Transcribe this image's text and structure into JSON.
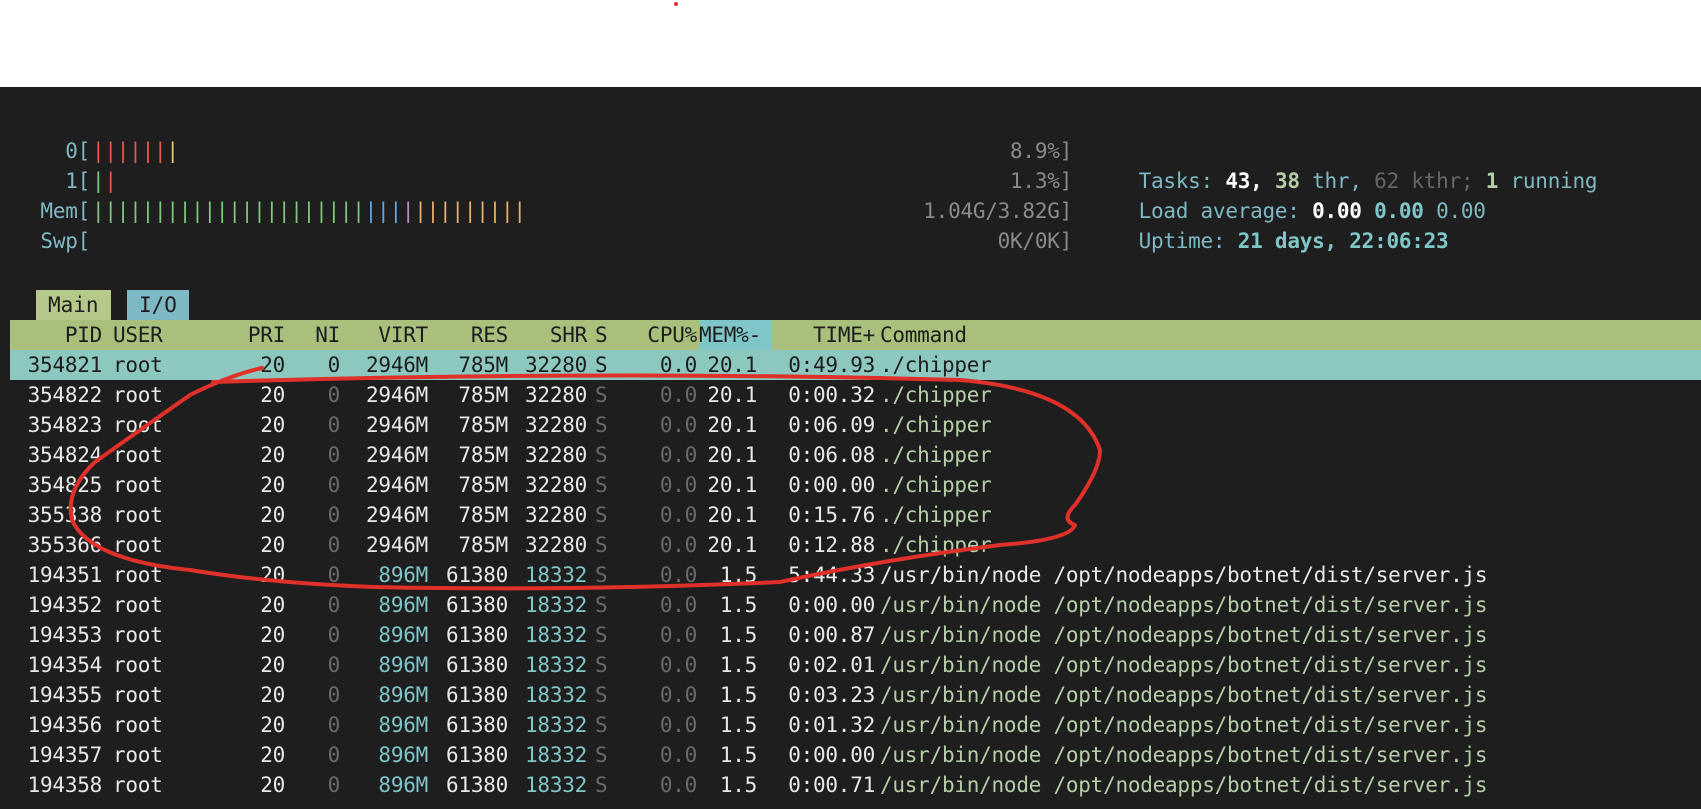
{
  "meters": {
    "cpu0": {
      "label": "0[",
      "value": "8.9%]"
    },
    "cpu1": {
      "label": "1[",
      "value": "1.3%]"
    },
    "mem": {
      "label": "Mem[",
      "value": "1.04G/3.82G]"
    },
    "swp": {
      "label": "Swp[",
      "value": "0K/0K]"
    }
  },
  "stats": {
    "tasks_label": "Tasks:",
    "tasks": "43,",
    "threads": "38",
    "threads_label": "thr,",
    "kthreads": "62",
    "kthreads_label": "kthr;",
    "running": "1",
    "running_label": "running",
    "load_label": "Load average:",
    "load1": "0.00",
    "load5": "0.00",
    "load15": "0.00",
    "uptime_label": "Uptime:",
    "uptime": "21 days, 22:06:23"
  },
  "tabs": {
    "main": "Main",
    "io": "I/O"
  },
  "columns": {
    "pid": "PID",
    "user": "USER",
    "pri": "PRI",
    "ni": "NI",
    "virt": "VIRT",
    "res": "RES",
    "shr": "SHR",
    "s": "S",
    "cpu": "CPU%",
    "mem": "MEM%-",
    "time": "TIME+",
    "command": "Command"
  },
  "rows": [
    {
      "pid": "354821",
      "user": "root",
      "pri": "20",
      "ni": "0",
      "virt": "2946M",
      "res": "785M",
      "shr": "32280",
      "s": "S",
      "cpu": "0.0",
      "mem": "20.1",
      "time": "0:49.93",
      "command": "./chipper"
    },
    {
      "pid": "354822",
      "user": "root",
      "pri": "20",
      "ni": "0",
      "virt": "2946M",
      "res": "785M",
      "shr": "32280",
      "s": "S",
      "cpu": "0.0",
      "mem": "20.1",
      "time": "0:00.32",
      "command": "./chipper"
    },
    {
      "pid": "354823",
      "user": "root",
      "pri": "20",
      "ni": "0",
      "virt": "2946M",
      "res": "785M",
      "shr": "32280",
      "s": "S",
      "cpu": "0.0",
      "mem": "20.1",
      "time": "0:06.09",
      "command": "./chipper"
    },
    {
      "pid": "354824",
      "user": "root",
      "pri": "20",
      "ni": "0",
      "virt": "2946M",
      "res": "785M",
      "shr": "32280",
      "s": "S",
      "cpu": "0.0",
      "mem": "20.1",
      "time": "0:06.08",
      "command": "./chipper"
    },
    {
      "pid": "354825",
      "user": "root",
      "pri": "20",
      "ni": "0",
      "virt": "2946M",
      "res": "785M",
      "shr": "32280",
      "s": "S",
      "cpu": "0.0",
      "mem": "20.1",
      "time": "0:00.00",
      "command": "./chipper"
    },
    {
      "pid": "355338",
      "user": "root",
      "pri": "20",
      "ni": "0",
      "virt": "2946M",
      "res": "785M",
      "shr": "32280",
      "s": "S",
      "cpu": "0.0",
      "mem": "20.1",
      "time": "0:15.76",
      "command": "./chipper"
    },
    {
      "pid": "355366",
      "user": "root",
      "pri": "20",
      "ni": "0",
      "virt": "2946M",
      "res": "785M",
      "shr": "32280",
      "s": "S",
      "cpu": "0.0",
      "mem": "20.1",
      "time": "0:12.88",
      "command": "./chipper"
    },
    {
      "pid": "194351",
      "user": "root",
      "pri": "20",
      "ni": "0",
      "virt": "896M",
      "res": "61380",
      "shr": "18332",
      "s": "S",
      "cpu": "0.0",
      "mem": "1.5",
      "time": "5:44.33",
      "command": "/usr/bin/node /opt/nodeapps/botnet/dist/server.js"
    },
    {
      "pid": "194352",
      "user": "root",
      "pri": "20",
      "ni": "0",
      "virt": "896M",
      "res": "61380",
      "shr": "18332",
      "s": "S",
      "cpu": "0.0",
      "mem": "1.5",
      "time": "0:00.00",
      "command": "/usr/bin/node /opt/nodeapps/botnet/dist/server.js"
    },
    {
      "pid": "194353",
      "user": "root",
      "pri": "20",
      "ni": "0",
      "virt": "896M",
      "res": "61380",
      "shr": "18332",
      "s": "S",
      "cpu": "0.0",
      "mem": "1.5",
      "time": "0:00.87",
      "command": "/usr/bin/node /opt/nodeapps/botnet/dist/server.js"
    },
    {
      "pid": "194354",
      "user": "root",
      "pri": "20",
      "ni": "0",
      "virt": "896M",
      "res": "61380",
      "shr": "18332",
      "s": "S",
      "cpu": "0.0",
      "mem": "1.5",
      "time": "0:02.01",
      "command": "/usr/bin/node /opt/nodeapps/botnet/dist/server.js"
    },
    {
      "pid": "194355",
      "user": "root",
      "pri": "20",
      "ni": "0",
      "virt": "896M",
      "res": "61380",
      "shr": "18332",
      "s": "S",
      "cpu": "0.0",
      "mem": "1.5",
      "time": "0:03.23",
      "command": "/usr/bin/node /opt/nodeapps/botnet/dist/server.js"
    },
    {
      "pid": "194356",
      "user": "root",
      "pri": "20",
      "ni": "0",
      "virt": "896M",
      "res": "61380",
      "shr": "18332",
      "s": "S",
      "cpu": "0.0",
      "mem": "1.5",
      "time": "0:01.32",
      "command": "/usr/bin/node /opt/nodeapps/botnet/dist/server.js"
    },
    {
      "pid": "194357",
      "user": "root",
      "pri": "20",
      "ni": "0",
      "virt": "896M",
      "res": "61380",
      "shr": "18332",
      "s": "S",
      "cpu": "0.0",
      "mem": "1.5",
      "time": "0:00.00",
      "command": "/usr/bin/node /opt/nodeapps/botnet/dist/server.js"
    },
    {
      "pid": "194358",
      "user": "root",
      "pri": "20",
      "ni": "0",
      "virt": "896M",
      "res": "61380",
      "shr": "18332",
      "s": "S",
      "cpu": "0.0",
      "mem": "1.5",
      "time": "0:00.71",
      "command": "/usr/bin/node /opt/nodeapps/botnet/dist/server.js"
    }
  ],
  "colors": {
    "terminal_bg": "#1e1e1e",
    "header_bg": "#a8c07c",
    "selected_bg": "#8cc8c0",
    "annotation_red": "#e0302a"
  }
}
